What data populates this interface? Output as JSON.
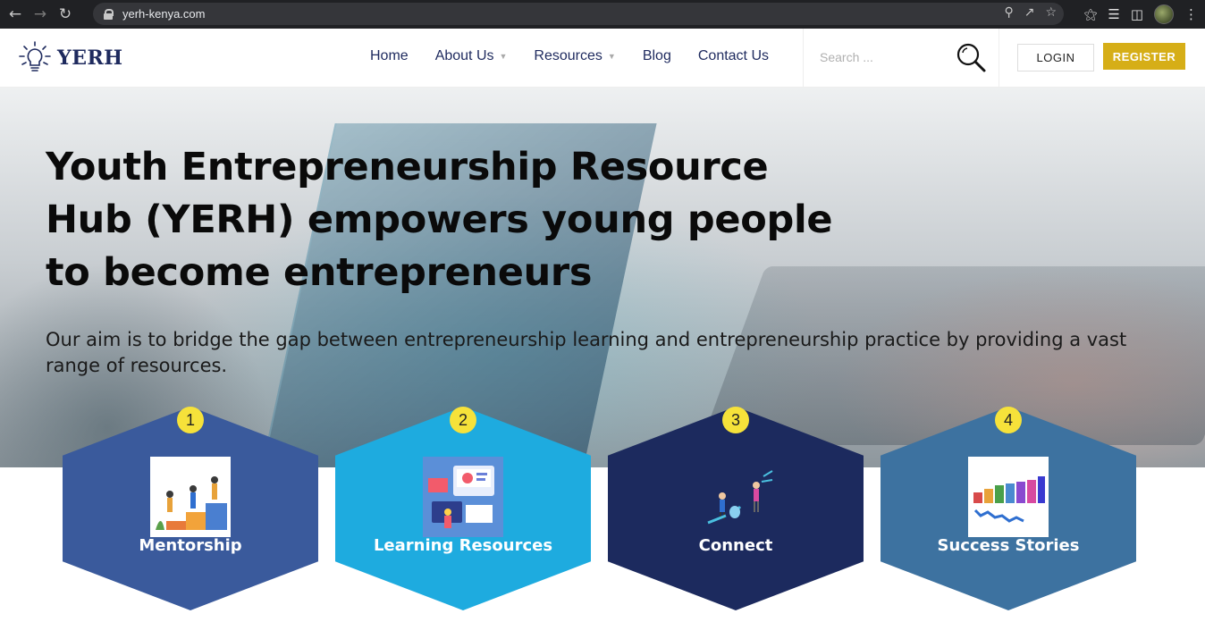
{
  "browser": {
    "url": "yerh-kenya.com",
    "back_icon": "back-arrow-icon",
    "forward_icon": "forward-arrow-icon",
    "reload_icon": "reload-icon"
  },
  "header": {
    "logo_text": "YERH",
    "nav": [
      {
        "label": "Home"
      },
      {
        "label": "About Us"
      },
      {
        "label": "Resources"
      },
      {
        "label": "Blog"
      },
      {
        "label": "Contact Us"
      }
    ],
    "search_placeholder": "Search ...",
    "login_label": "LOGIN",
    "register_label": "REGISTER"
  },
  "hero": {
    "title": "Youth Entrepreneurship Resource Hub (YERH) empowers young people to become entrepreneurs",
    "subtitle": "Our aim is to bridge the gap between entrepreneurship learning and entrepreneurship practice by providing a vast range of resources."
  },
  "features": [
    {
      "number": "1",
      "label": "Mentorship",
      "color": "#3a5a9c",
      "icon": "mentorship-illustration"
    },
    {
      "number": "2",
      "label": "Learning Resources",
      "color": "#1eabdf",
      "icon": "learning-resources-illustration"
    },
    {
      "number": "3",
      "label": "Connect",
      "color": "#1c2a5e",
      "icon": "connect-illustration"
    },
    {
      "number": "4",
      "label": "Success Stories",
      "color": "#3d72a0",
      "icon": "success-story-illustration"
    }
  ],
  "colors": {
    "brand_navy": "#1e2a5e",
    "register_gold": "#d6ae17",
    "badge_yellow": "#f6e23a"
  }
}
